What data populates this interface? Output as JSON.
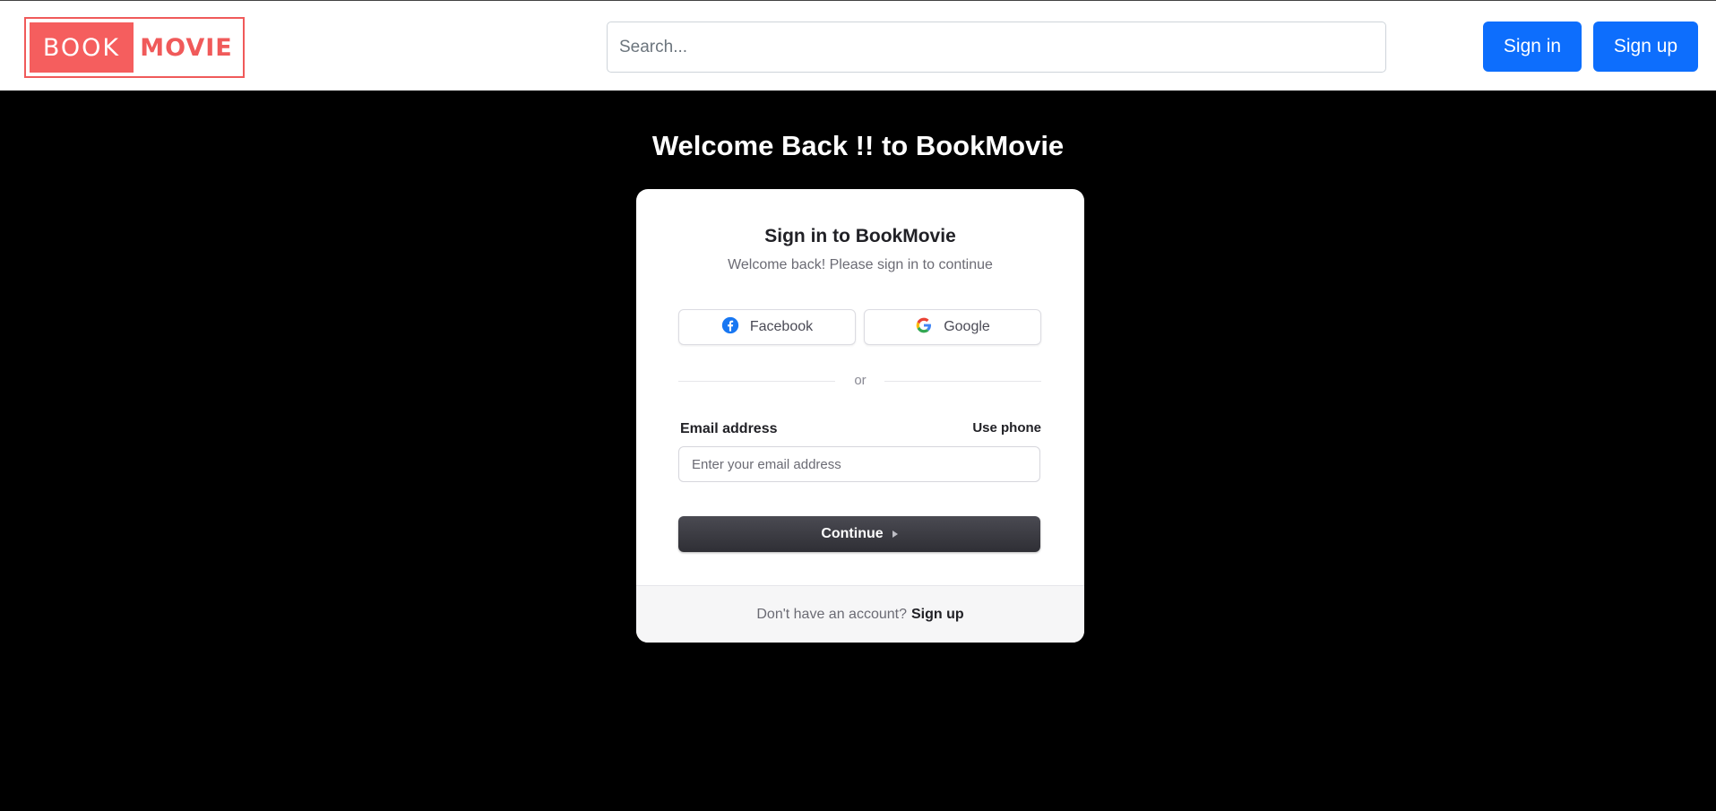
{
  "header": {
    "logo_book": "BOOK",
    "logo_movie": "MOVIE",
    "search_placeholder": "Search...",
    "signin_label": "Sign in",
    "signup_label": "Sign up"
  },
  "welcome_heading": "Welcome Back !! to BookMovie",
  "card": {
    "title": "Sign in to BookMovie",
    "subtitle": "Welcome back! Please sign in to continue",
    "facebook_label": "Facebook",
    "google_label": "Google",
    "divider_text": "or",
    "email_label": "Email address",
    "use_phone_label": "Use phone",
    "email_placeholder": "Enter your email address",
    "continue_label": "Continue",
    "footer_text": "Don't have an account?",
    "footer_link": "Sign up"
  },
  "colors": {
    "brand_red": "#f55e5e",
    "primary_blue": "#0d6efd",
    "page_background": "#000000"
  },
  "icons": [
    "facebook-icon",
    "google-icon",
    "caret-right-icon"
  ]
}
